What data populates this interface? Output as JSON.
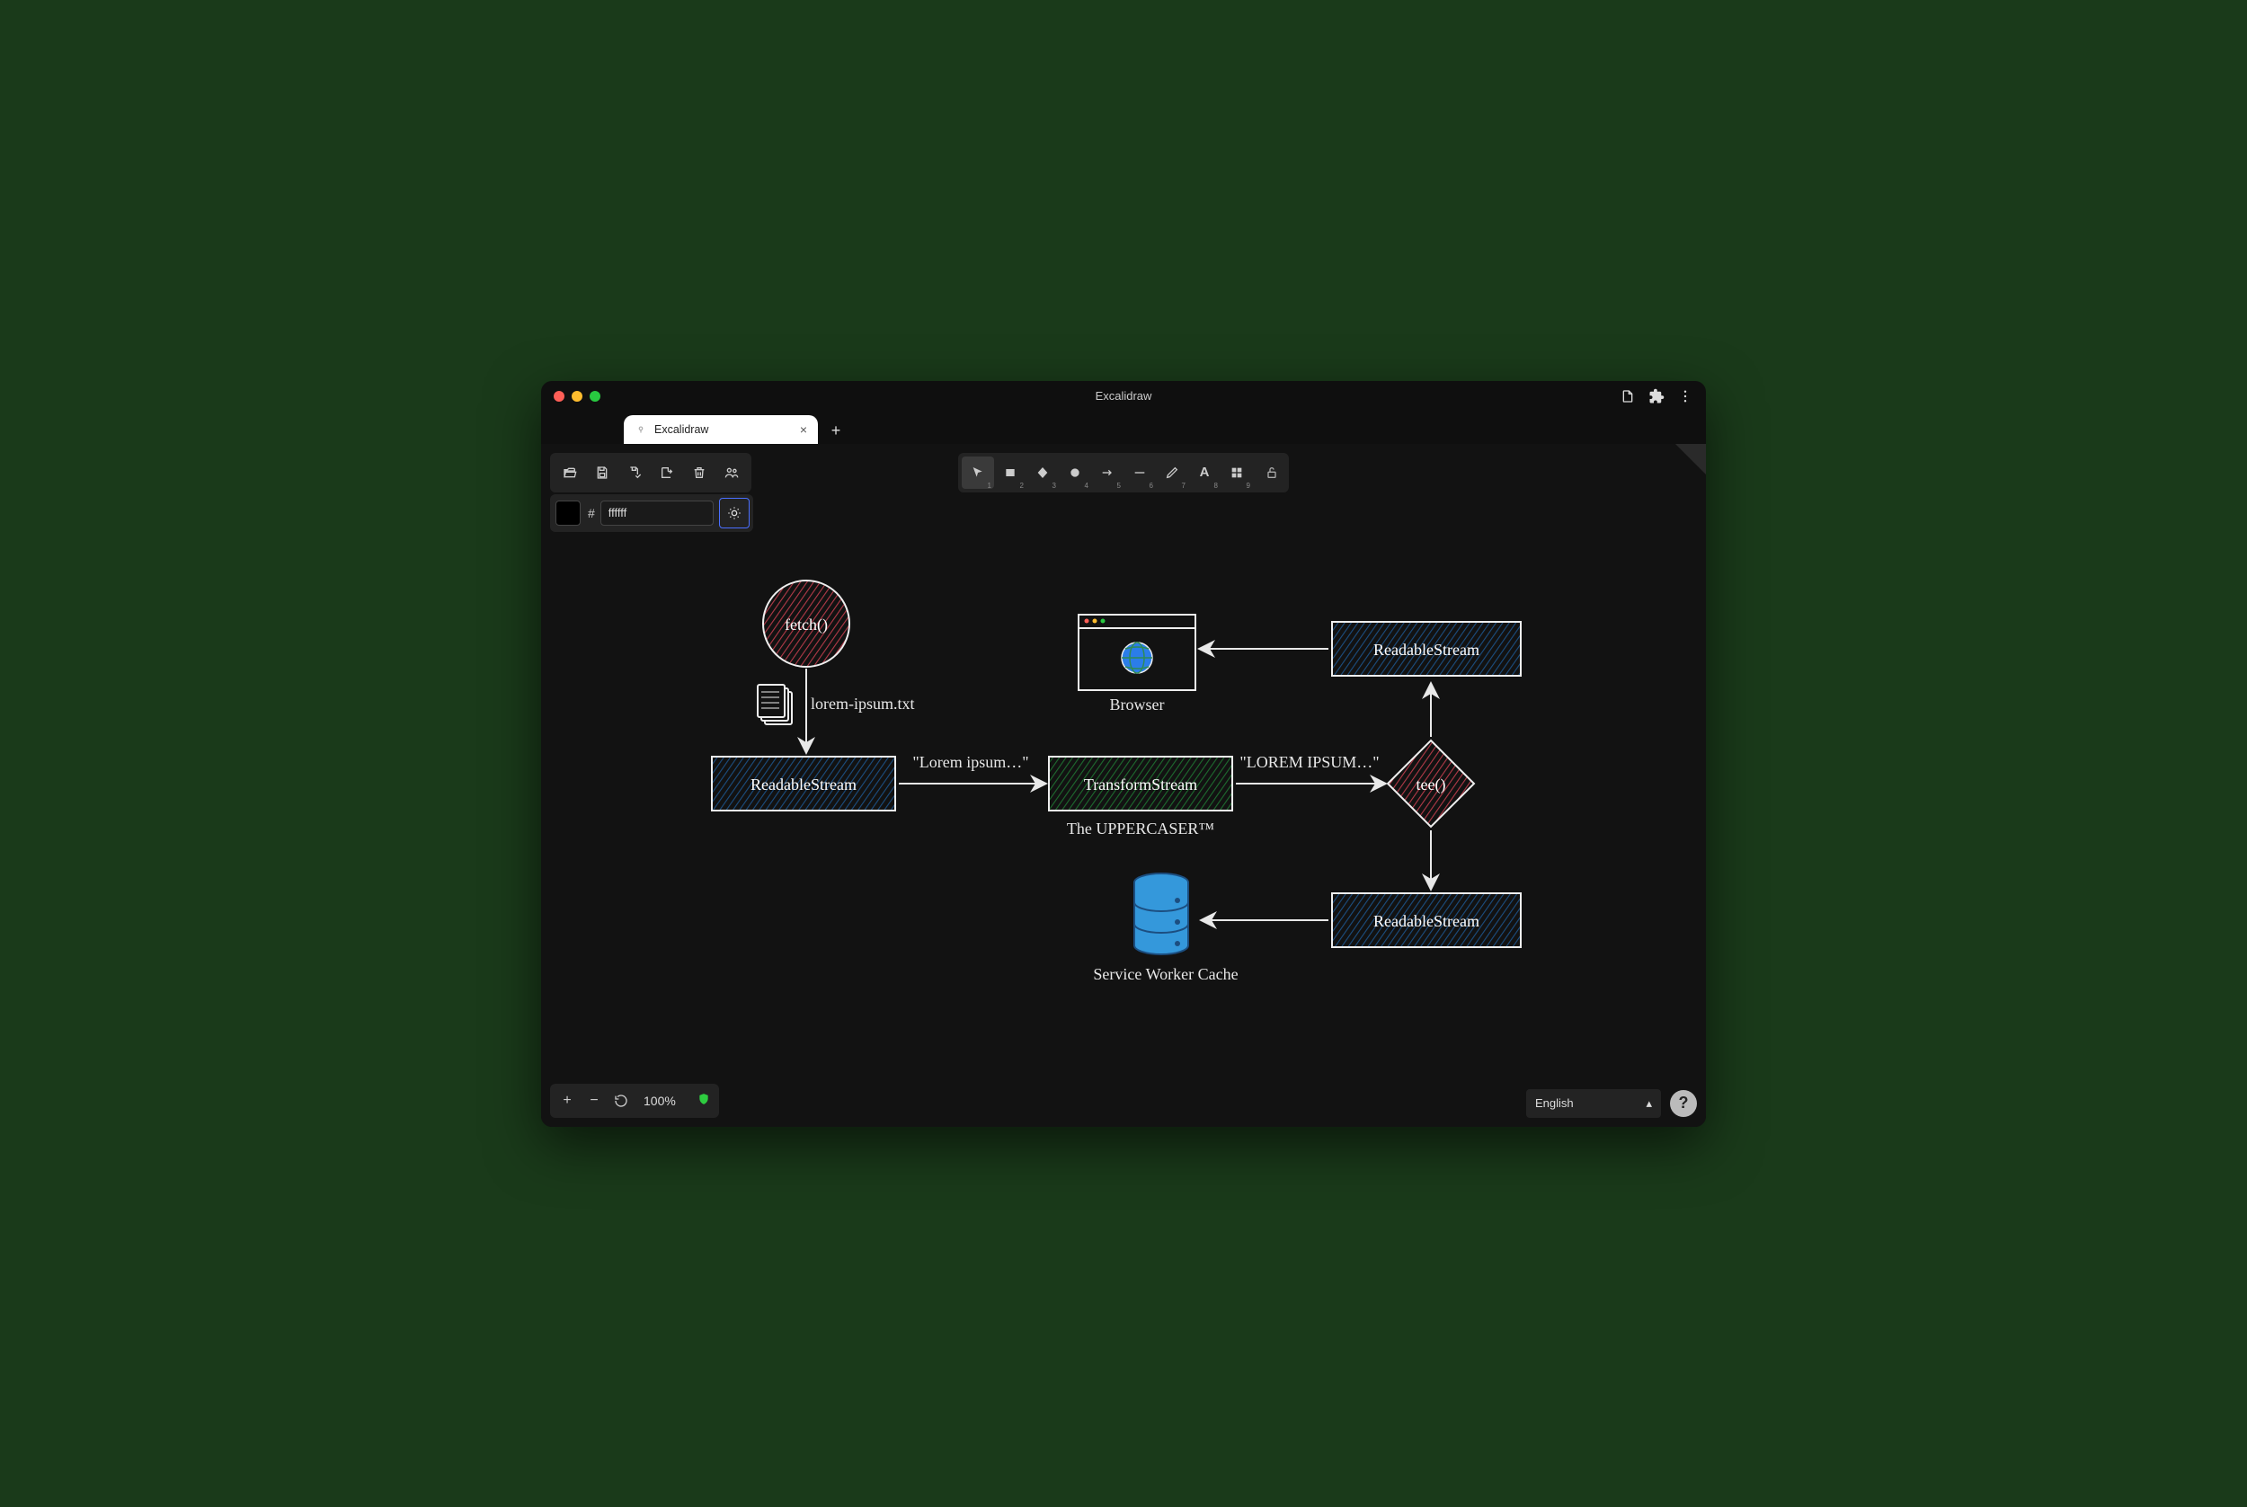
{
  "window": {
    "title": "Excalidraw"
  },
  "tab": {
    "title": "Excalidraw"
  },
  "color_input": {
    "value": "ffffff",
    "prefix": "#"
  },
  "tools": {
    "keys": {
      "select": "1",
      "rect": "2",
      "diamond": "3",
      "ellipse": "4",
      "arrow": "5",
      "line": "6",
      "draw": "7",
      "text": "8",
      "image": "9"
    }
  },
  "zoom": "100%",
  "language": "English",
  "diagram": {
    "fetch": "fetch()",
    "file_label": "lorem-ipsum.txt",
    "readable1": "ReadableStream",
    "lorem_lower": "\"Lorem ipsum…\"",
    "transform": "TransformStream",
    "transform_caption": "The UPPERCASER™",
    "lorem_upper": "\"LOREM IPSUM…\"",
    "tee": "tee()",
    "readable2": "ReadableStream",
    "browser": "Browser",
    "readable3": "ReadableStream",
    "swcache": "Service Worker Cache"
  }
}
